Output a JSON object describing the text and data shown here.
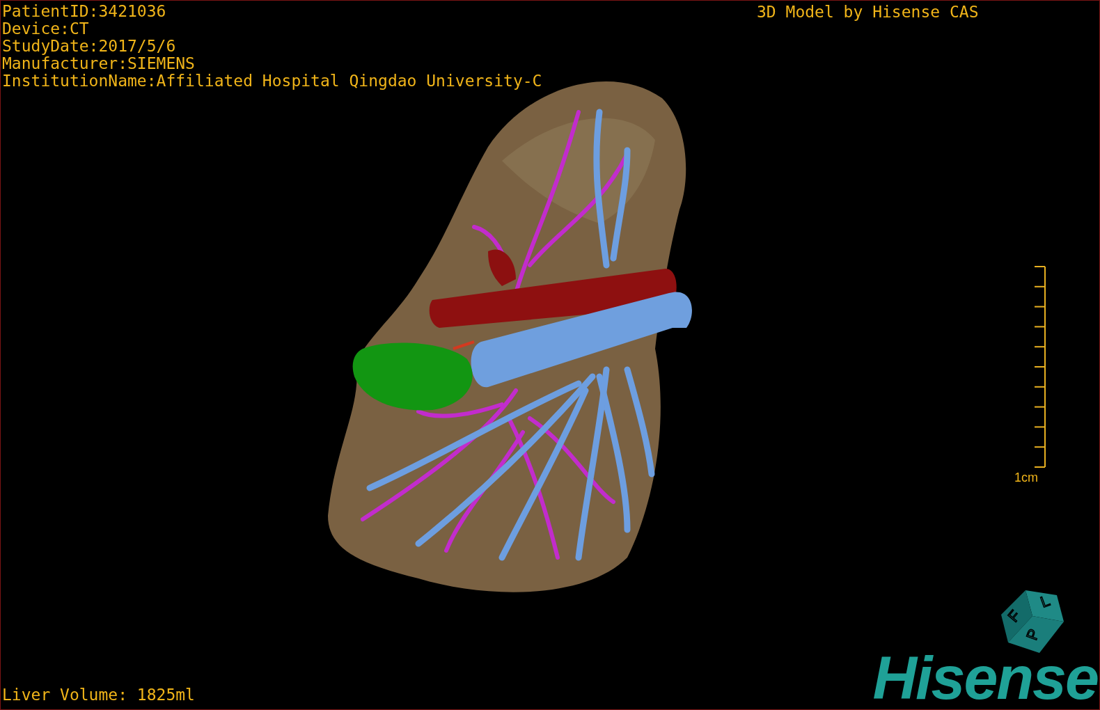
{
  "patient_info": [
    "PatientID:3421036",
    "Device:CT",
    "StudyDate:2017/5/6",
    "Manufacturer:SIEMENS",
    "InstitutionName:Affiliated Hospital Qingdao University-C"
  ],
  "title": "3D Model by Hisense CAS",
  "scale_bar": {
    "label": "1cm"
  },
  "orientation_cube": {
    "labels": [
      "F",
      "L",
      "P"
    ]
  },
  "logo": "Hisense",
  "liver_volume": "Liver Volume: 1825ml"
}
